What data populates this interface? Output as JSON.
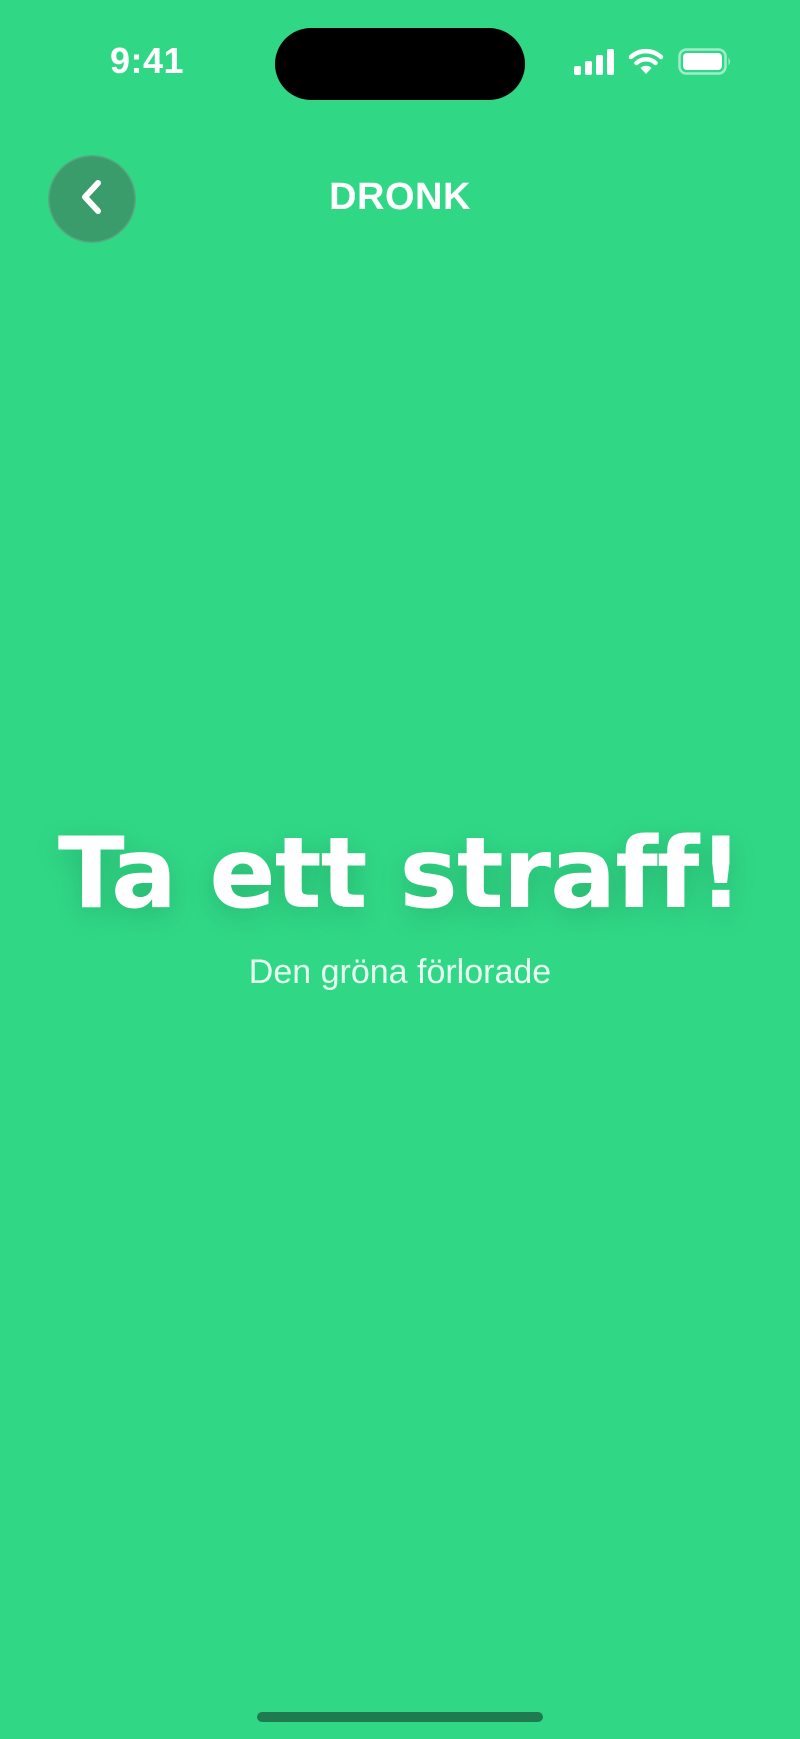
{
  "status_bar": {
    "time": "9:41",
    "icons": [
      "cellular-signal-icon",
      "wifi-icon",
      "battery-icon"
    ]
  },
  "header": {
    "title": "DRONK",
    "back_icon": "chevron-left-icon"
  },
  "main": {
    "headline": "Ta ett straff!",
    "subtitle": "Den gröna förlorade"
  },
  "colors": {
    "background": "#30d886",
    "back_button": "#3a9b6b",
    "text": "#ffffff",
    "home_indicator": "#1f7b4f"
  }
}
